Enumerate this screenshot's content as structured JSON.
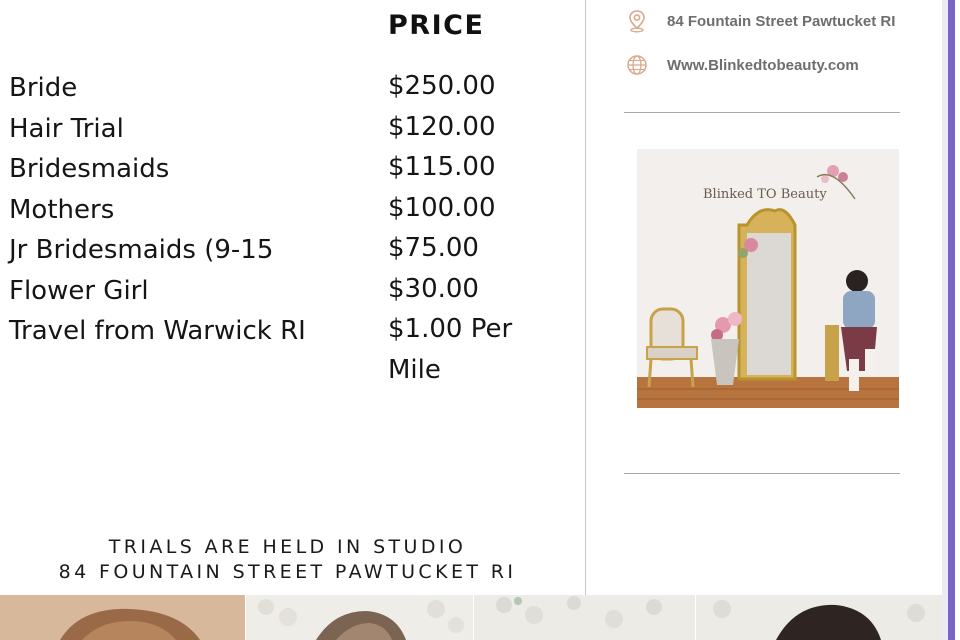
{
  "price_header": "PRICE",
  "services": [
    {
      "name": "Bride",
      "price": "$250.00"
    },
    {
      "name": "Hair Trial",
      "price": "$120.00"
    },
    {
      "name": "Bridesmaids",
      "price": "$115.00"
    },
    {
      "name": "Mothers",
      "price": "$100.00"
    },
    {
      "name": "Jr Bridesmaids (9-15",
      "price": "$75.00"
    },
    {
      "name": "Flower Girl",
      "price": "$30.00"
    },
    {
      "name": "Travel from Warwick RI",
      "price": "$1.00 Per Mile"
    }
  ],
  "trials_note": {
    "line1": "TRIALS ARE HELD IN STUDIO",
    "line2": "84 FOUNTAIN STREET PAWTUCKET RI"
  },
  "contact": {
    "address": "84 Fountain Street Pawtucket RI",
    "website": "Www.Blinkedtobeauty.com",
    "address_icon": "location-pin-icon",
    "website_icon": "globe-icon"
  },
  "studio_photo": {
    "sign_text": "Blinked TO Beauty"
  },
  "colors": {
    "accent": "#7b62c9",
    "icon": "#d9a98a",
    "contact_text": "#6e6e6e"
  }
}
